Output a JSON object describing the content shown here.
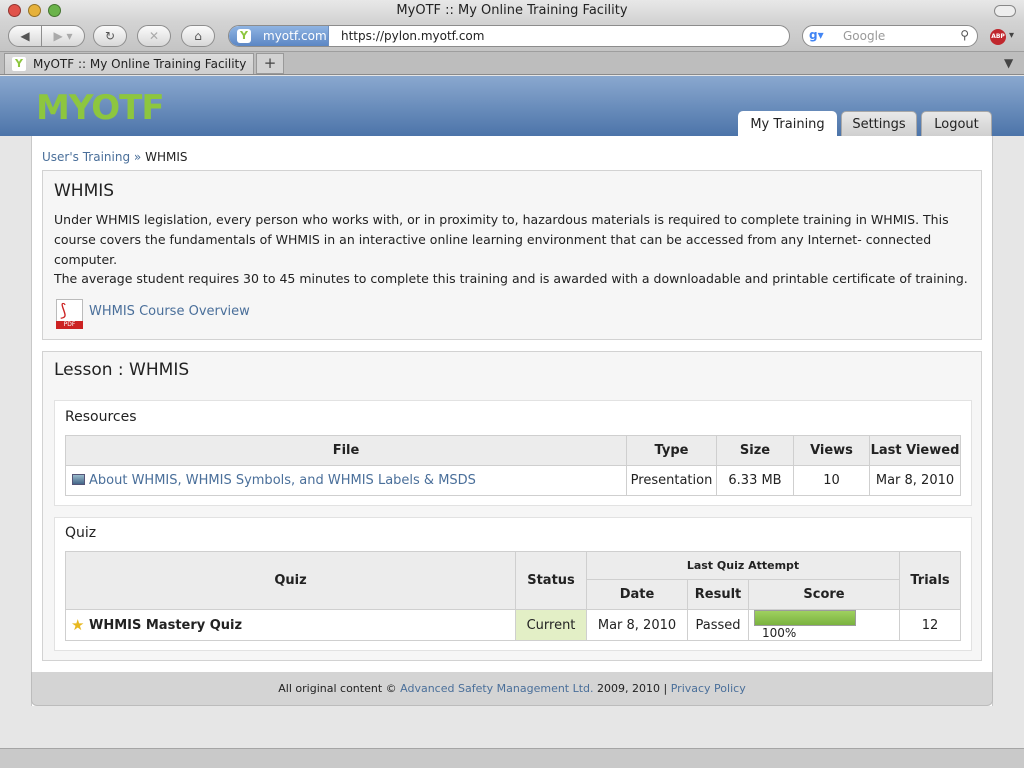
{
  "window": {
    "title": "MyOTF :: My Online Training Facility"
  },
  "browser": {
    "site_badge": "myotf.com",
    "url": "https://pylon.myotf.com",
    "search_placeholder": "Google",
    "adblock_label": "ABP",
    "tab_title": "MyOTF :: My Online Training Facility",
    "new_tab": "+"
  },
  "header": {
    "logo_text": "MYOTF",
    "nav": [
      "My Training",
      "Settings",
      "Logout"
    ],
    "active_nav": "My Training"
  },
  "breadcrumb": {
    "parent": "User's Training",
    "separator": "»",
    "current": "WHMIS"
  },
  "course": {
    "title": "WHMIS",
    "description_1": "Under WHMIS legislation, every person who works with, or in proximity to, hazardous materials is required to complete training in WHMIS. This course covers the fundamentals of WHMIS in an interactive online learning environment that can be accessed from any Internet- connected computer.",
    "description_2": "The average student requires 30 to 45 minutes to complete this training and is awarded with a downloadable and printable certificate of training.",
    "overview_link": "WHMIS Course Overview",
    "pdf_icon": "pdf-icon"
  },
  "lesson": {
    "title": "Lesson : WHMIS",
    "resources": {
      "heading": "Resources",
      "columns": [
        "File",
        "Type",
        "Size",
        "Views",
        "Last Viewed"
      ],
      "rows": [
        {
          "file": "About WHMIS, WHMIS Symbols, and WHMIS Labels & MSDS",
          "type": "Presentation",
          "size": "6.33 MB",
          "views": "10",
          "last_viewed": "Mar 8, 2010"
        }
      ]
    },
    "quiz": {
      "heading": "Quiz",
      "columns": {
        "quiz": "Quiz",
        "status": "Status",
        "last_attempt": "Last Quiz Attempt",
        "date": "Date",
        "result": "Result",
        "score": "Score",
        "trials": "Trials"
      },
      "rows": [
        {
          "name": "WHMIS Mastery Quiz",
          "status": "Current",
          "date": "Mar 8, 2010",
          "result": "Passed",
          "score": "100%",
          "score_value": 1.0,
          "trials": "12"
        }
      ]
    }
  },
  "footer": {
    "prefix": "All original content ©",
    "company": "Advanced Safety Management Ltd.",
    "years": "2009, 2010 |",
    "privacy": "Privacy Policy"
  },
  "colors": {
    "header_blue": "#4c74a9",
    "logo_green": "#8dc63f",
    "link": "#4a6f9a",
    "status_current_bg": "#e3efc6",
    "score_bar": "#8cc152"
  }
}
